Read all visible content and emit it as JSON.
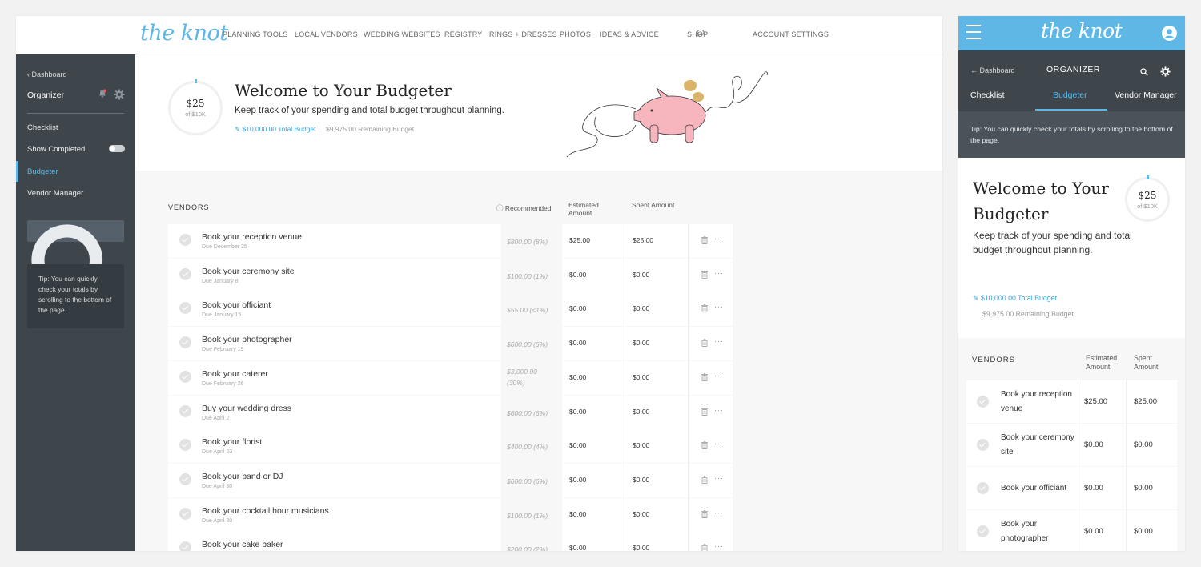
{
  "desktop": {
    "logo": "the knot",
    "nav": [
      "PLANNING TOOLS",
      "LOCAL VENDORS",
      "WEDDING WEBSITES",
      "REGISTRY",
      "RINGS + DRESSES",
      "PHOTOS",
      "IDEAS & ADVICE",
      "SHOP"
    ],
    "account": "ACCOUNT SETTINGS",
    "sidebar": {
      "back": "Dashboard",
      "title": "Organizer",
      "items": [
        "Checklist",
        "Show Completed",
        "Budgeter",
        "Vendor Manager"
      ],
      "search": "Search",
      "tip": "Tip: You can quickly check your totals by scrolling to the bottom of the page."
    },
    "hero": {
      "amount": "$25",
      "of": "of $10K",
      "title": "Welcome to Your Budgeter",
      "subtitle": "Keep track of your spending and total budget throughout planning.",
      "total": "$10,000.00 Total Budget",
      "remaining": "$9,975.00 Remaining Budget"
    },
    "table": {
      "vendors": "VENDORS",
      "recommended": "Recommended",
      "estimated": "Estimated Amount",
      "spent": "Spent Amount",
      "rows": [
        {
          "name": "Book your reception venue",
          "due": "Due December 25",
          "rec": "$800.00 (8%)",
          "est": "$25.00",
          "spent": "$25.00"
        },
        {
          "name": "Book your ceremony site",
          "due": "Due January 8",
          "rec": "$100.00 (1%)",
          "est": "$0.00",
          "spent": "$0.00"
        },
        {
          "name": "Book your officiant",
          "due": "Due January 15",
          "rec": "$55.00 (<1%)",
          "est": "$0.00",
          "spent": "$0.00"
        },
        {
          "name": "Book your photographer",
          "due": "Due February 19",
          "rec": "$600.00 (6%)",
          "est": "$0.00",
          "spent": "$0.00"
        },
        {
          "name": "Book your caterer",
          "due": "Due February 26",
          "rec": "$3,000.00 (30%)",
          "est": "$0.00",
          "spent": "$0.00"
        },
        {
          "name": "Buy your wedding dress",
          "due": "Due April 2",
          "rec": "$600.00 (6%)",
          "est": "$0.00",
          "spent": "$0.00"
        },
        {
          "name": "Book your florist",
          "due": "Due April 23",
          "rec": "$400.00 (4%)",
          "est": "$0.00",
          "spent": "$0.00"
        },
        {
          "name": "Book your band or DJ",
          "due": "Due April 30",
          "rec": "$600.00 (6%)",
          "est": "$0.00",
          "spent": "$0.00"
        },
        {
          "name": "Book your cocktail hour musicians",
          "due": "Due April 30",
          "rec": "$100.00 (1%)",
          "est": "$0.00",
          "spent": "$0.00"
        },
        {
          "name": "Book your cake baker",
          "due": "",
          "rec": "$200.00 (2%)",
          "est": "$0.00",
          "spent": "$0.00"
        }
      ]
    }
  },
  "mobile": {
    "logo": "the knot",
    "back": "Dashboard",
    "title": "ORGANIZER",
    "tabs": [
      "Checklist",
      "Budgeter",
      "Vendor Manager"
    ],
    "tip": "Tip: You can quickly check your totals by scrolling to the bottom of the page.",
    "hero": {
      "title": "Welcome to Your Budgeter",
      "amount": "$25",
      "of": "of $10K",
      "subtitle": "Keep track of your spending and total budget throughout planning.",
      "total": "$10,000.00 Total Budget",
      "remaining": "$9,975.00 Remaining Budget"
    },
    "table": {
      "vendors": "VENDORS",
      "estimated": "Estimated Amount",
      "spent": "Spent Amount",
      "rows": [
        {
          "name": "Book your reception venue",
          "est": "$25.00",
          "spent": "$25.00"
        },
        {
          "name": "Book your ceremony site",
          "est": "$0.00",
          "spent": "$0.00"
        },
        {
          "name": "Book your officiant",
          "est": "$0.00",
          "spent": "$0.00"
        },
        {
          "name": "Book your photographer",
          "est": "$0.00",
          "spent": "$0.00"
        }
      ]
    }
  },
  "colors": {
    "brand": "#5fb7e5",
    "sidebar": "#3e464c",
    "link": "#3a9fd6",
    "pig": "#f7b6bd",
    "coin": "#d9b46a"
  }
}
